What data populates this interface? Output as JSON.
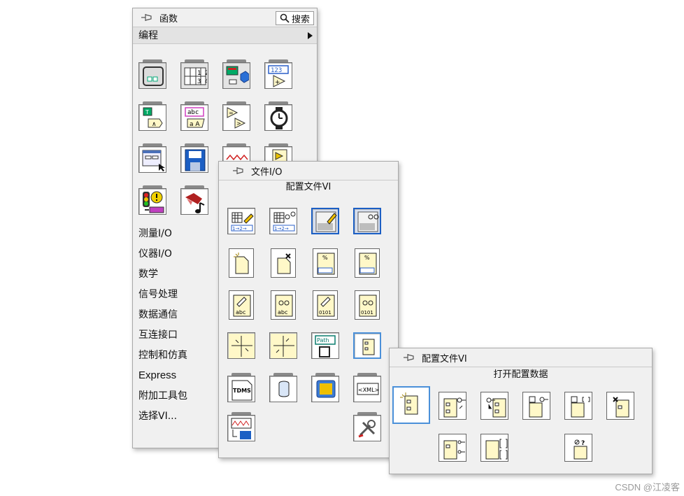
{
  "functions_palette": {
    "title": "函数",
    "search_label": "搜索",
    "current_category": "编程",
    "categories": [
      "测量I/O",
      "仪器I/O",
      "数学",
      "信号处理",
      "数据通信",
      "互连接口",
      "控制和仿真",
      "Express",
      "附加工具包",
      "选择VI..."
    ]
  },
  "file_io_palette": {
    "title": "文件I/O",
    "selected_item_label": "配置文件VI"
  },
  "config_file_palette": {
    "title": "配置文件VI",
    "selected_item_label": "打开配置数据"
  },
  "icon_texts": {
    "numeric_display": "123",
    "string_abc": "abc",
    "string_aa": "a A",
    "tdms": "TDMS",
    "xml": "<XML>",
    "path": "Path",
    "binary": "0101",
    "spreadsheet_nums": "1→2→",
    "percent": "%"
  },
  "watermark": "CSDN @江凌客",
  "colors": {
    "accent_blue": "#3b7bd4",
    "selection_border": "#4a90d9",
    "icon_yellow": "#fff8c8"
  }
}
